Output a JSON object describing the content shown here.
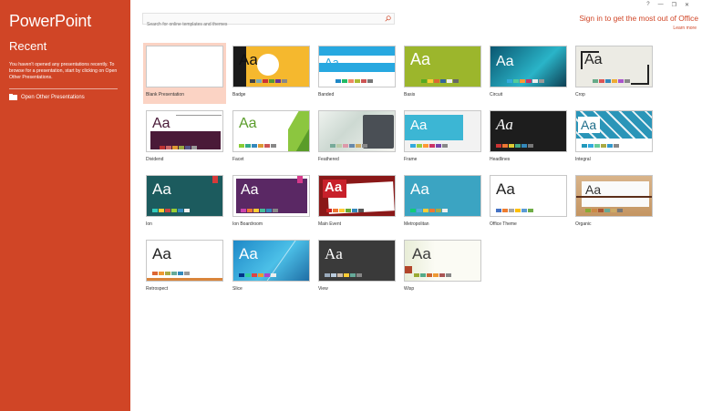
{
  "app": {
    "brand": "PowerPoint",
    "recent_heading": "Recent",
    "recent_message": "You haven't opened any presentations recently. To browse for a presentation, start by clicking on Open Other Presentations.",
    "open_other": "Open Other Presentations"
  },
  "window_controls": {
    "help": "?",
    "minimize": "—",
    "restore": "❐",
    "close": "✕"
  },
  "search": {
    "placeholder": "Search for online templates and themes"
  },
  "account": {
    "signin": "Sign in to get the most out of Office",
    "learn_more": "Learn more"
  },
  "colors": {
    "accent": "#d04526"
  },
  "templates": [
    {
      "name": "Blank Presentation"
    },
    {
      "name": "Badge"
    },
    {
      "name": "Banded"
    },
    {
      "name": "Basis"
    },
    {
      "name": "Circuit"
    },
    {
      "name": "Crop"
    },
    {
      "name": "Dividend"
    },
    {
      "name": "Facet"
    },
    {
      "name": "Feathered"
    },
    {
      "name": "Frame"
    },
    {
      "name": "Headlines"
    },
    {
      "name": "Integral"
    },
    {
      "name": "Ion"
    },
    {
      "name": "Ion Boardroom"
    },
    {
      "name": "Main Event"
    },
    {
      "name": "Metropolitan"
    },
    {
      "name": "Office Theme"
    },
    {
      "name": "Organic"
    },
    {
      "name": "Retrospect"
    },
    {
      "name": "Slice"
    },
    {
      "name": "View"
    },
    {
      "name": "Wisp"
    }
  ],
  "thumb_glyph": "Aa"
}
